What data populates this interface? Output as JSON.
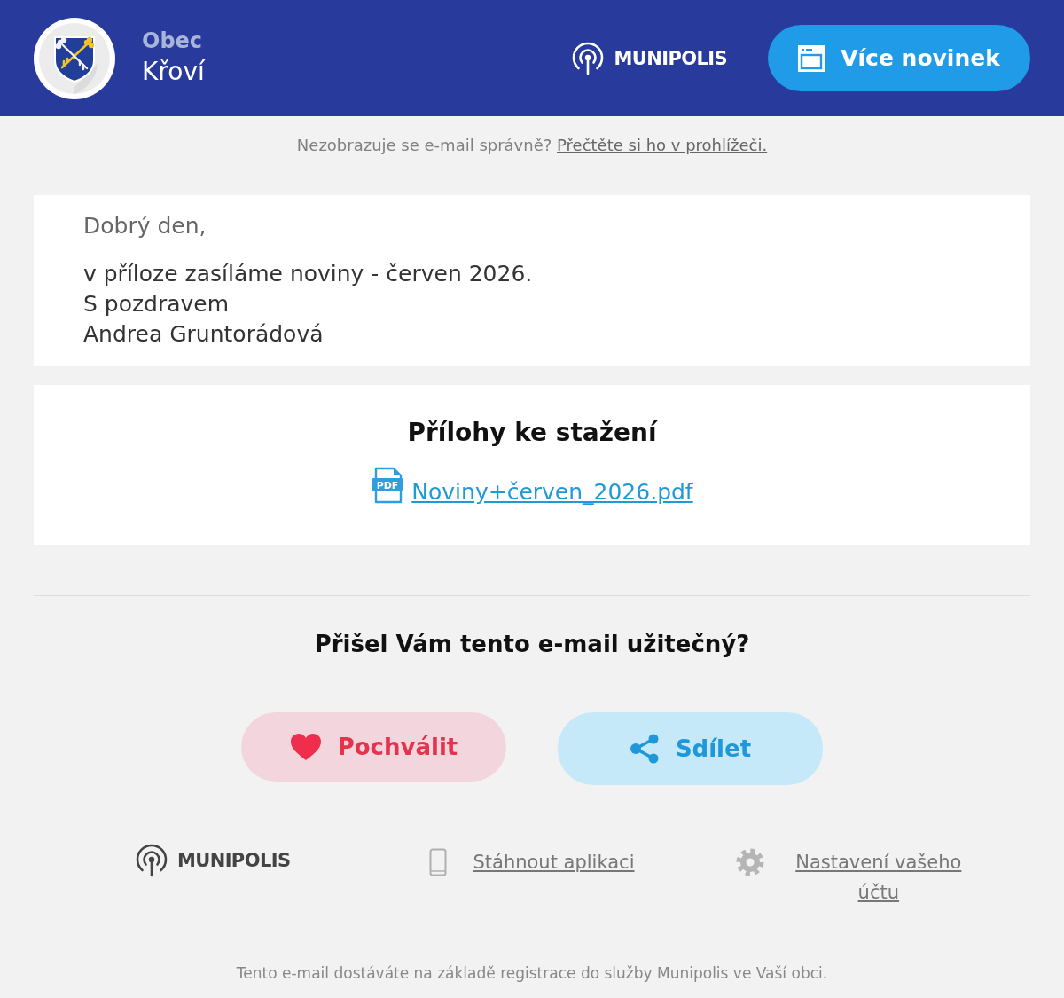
{
  "header": {
    "town": {
      "prefix": "Obec",
      "name": "Křoví"
    },
    "brand": "MUNIPOLIS",
    "more_news_button": "Více novinek"
  },
  "preheader": {
    "text": "Nezobrazuje se e-mail správně?",
    "link": "Přečtěte si ho v prohlížeči."
  },
  "message": {
    "greeting": "Dobrý den,",
    "lines": [
      "v příloze zasíláme noviny - červen 2026.",
      "S pozdravem",
      "Andrea Gruntorádová"
    ]
  },
  "attachments": {
    "title": "Přílohy ke stažení",
    "files": [
      {
        "name": "Noviny+červen_2026.pdf",
        "icon_label": "PDF"
      }
    ]
  },
  "feedback": {
    "question": "Přišel Vám tento e-mail užitečný?",
    "buttons": [
      {
        "label": "Pochválit",
        "kind": "like"
      },
      {
        "label": "Sdílet",
        "kind": "share"
      }
    ]
  },
  "footer": {
    "brand": "MUNIPOLIS",
    "links": [
      {
        "label": "Stáhnout aplikaci",
        "kind": "app"
      },
      {
        "label": "Nastavení vašeho účtu",
        "kind": "settings"
      }
    ],
    "note": "Tento e-mail dostáváte na základě registrace do služby Munipolis ve Vaší obci."
  }
}
